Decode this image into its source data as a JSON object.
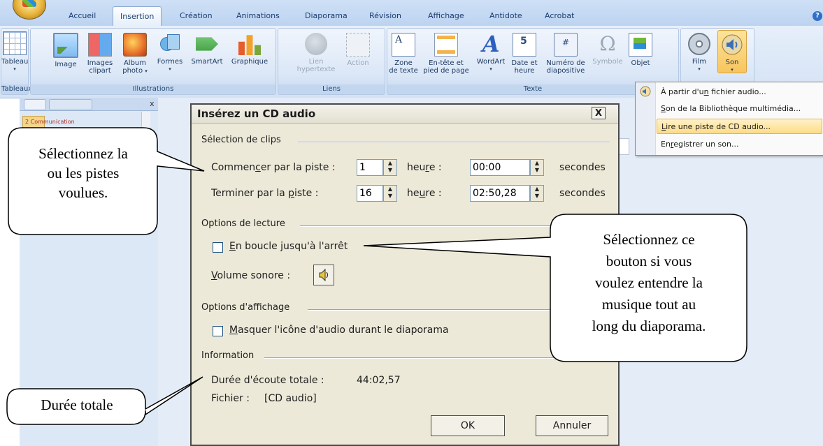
{
  "ribbon": {
    "tabs": [
      "Accueil",
      "Insertion",
      "Création",
      "Animations",
      "Diaporama",
      "Révision",
      "Affichage",
      "Antidote",
      "Acrobat"
    ],
    "active_tab": "Insertion",
    "groups": {
      "tableaux": {
        "label": "Tableaux",
        "buttons": [
          {
            "l1": "Tableau",
            "l2": ""
          }
        ]
      },
      "illustrations": {
        "label": "Illustrations",
        "buttons": [
          {
            "l1": "Image",
            "l2": ""
          },
          {
            "l1": "Images",
            "l2": "clipart"
          },
          {
            "l1": "Album",
            "l2": "photo"
          },
          {
            "l1": "Formes",
            "l2": ""
          },
          {
            "l1": "SmartArt",
            "l2": ""
          },
          {
            "l1": "Graphique",
            "l2": ""
          }
        ]
      },
      "liens": {
        "label": "Liens",
        "buttons": [
          {
            "l1": "Lien",
            "l2": "hypertexte"
          },
          {
            "l1": "Action",
            "l2": ""
          }
        ]
      },
      "texte": {
        "label": "Texte",
        "buttons": [
          {
            "l1": "Zone",
            "l2": "de texte"
          },
          {
            "l1": "En-tête et",
            "l2": "pied de page"
          },
          {
            "l1": "WordArt",
            "l2": ""
          },
          {
            "l1": "Date et",
            "l2": "heure"
          },
          {
            "l1": "Numéro de",
            "l2": "diapositive"
          },
          {
            "l1": "Symbole",
            "l2": ""
          },
          {
            "l1": "Objet",
            "l2": ""
          }
        ]
      },
      "media": {
        "buttons": [
          {
            "l1": "Film"
          },
          {
            "l1": "Son"
          }
        ]
      }
    }
  },
  "son_menu": {
    "items": [
      {
        "pre": "À partir d'u",
        "acc": "n",
        "post": " fichier audio..."
      },
      {
        "pre": "",
        "acc": "S",
        "post": "on de la Bibliothèque multimédia..."
      },
      {
        "pre": "",
        "acc": "L",
        "post": "ire une piste de CD audio..."
      },
      {
        "pre": "En",
        "acc": "r",
        "post": "egistrer un son..."
      }
    ],
    "highlighted_index": 2
  },
  "slide_pane": {
    "thumb_label": "2 Communication"
  },
  "dialog": {
    "title": "Insérez un CD audio",
    "close": "X",
    "sections": {
      "clips": "Sélection de clips",
      "lecture": "Options de lecture",
      "affichage": "Options d'affichage",
      "information": "Information"
    },
    "start_label": {
      "pre": "Commen",
      "acc": "c",
      "post": "er par la piste :"
    },
    "start_track": "1",
    "start_time_label": {
      "pre": "heu",
      "acc": "r",
      "post": "e :"
    },
    "start_time": "00:00",
    "end_label": {
      "pre": "Terminer par la ",
      "acc": "p",
      "post": "iste :"
    },
    "end_track": "16",
    "end_time_label": {
      "pre": "he",
      "acc": "u",
      "post": "re :"
    },
    "end_time": "02:50,28",
    "seconds": "secondes",
    "loop_label": {
      "acc": "E",
      "post": "n boucle jusqu'à l'arrêt"
    },
    "loop_checked": false,
    "volume_label": {
      "acc": "V",
      "post": "olume sonore :"
    },
    "hide_icon_label": {
      "acc": "M",
      "post": "asquer l'icône d'audio durant le diaporama"
    },
    "hide_icon_checked": false,
    "total_duration_label": "Durée d'écoute totale :",
    "total_duration": "44:02,57",
    "file_label": "Fichier :",
    "file_value": "[CD audio]",
    "ok": "OK",
    "cancel": "Annuler"
  },
  "callouts": {
    "tracks": [
      "Sélectionnez la",
      "ou les pistes",
      "voulues."
    ],
    "loop": [
      "Sélectionnez ce",
      "bouton si vous",
      "voulez entendre la",
      "musique tout au",
      "long du diaporama."
    ],
    "duration": "Durée totale"
  }
}
